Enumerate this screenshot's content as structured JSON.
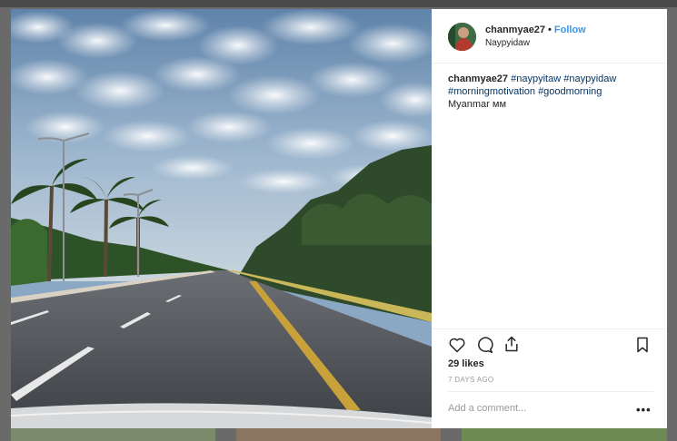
{
  "post": {
    "username": "chanmyae27",
    "separator": "•",
    "follow_label": "Follow",
    "location": "Naypyidaw",
    "caption": {
      "username": "chanmyae27",
      "hashtags": [
        "#naypyitaw",
        "#naypyidaw",
        "#morningmotivation",
        "#goodmorning"
      ],
      "text": "Myanmar ᴍᴍ"
    },
    "likes": "29 likes",
    "time_ago": "7 DAYS AGO",
    "comment_placeholder": "Add a comment...",
    "more_label": "•••"
  },
  "icons": {
    "like": "heart-icon",
    "comment": "comment-icon",
    "share": "share-icon",
    "save": "bookmark-icon",
    "more": "more-options-icon"
  },
  "colors": {
    "link": "#3897f0",
    "hashtag": "#003569",
    "text": "#262626",
    "muted": "#999999"
  }
}
